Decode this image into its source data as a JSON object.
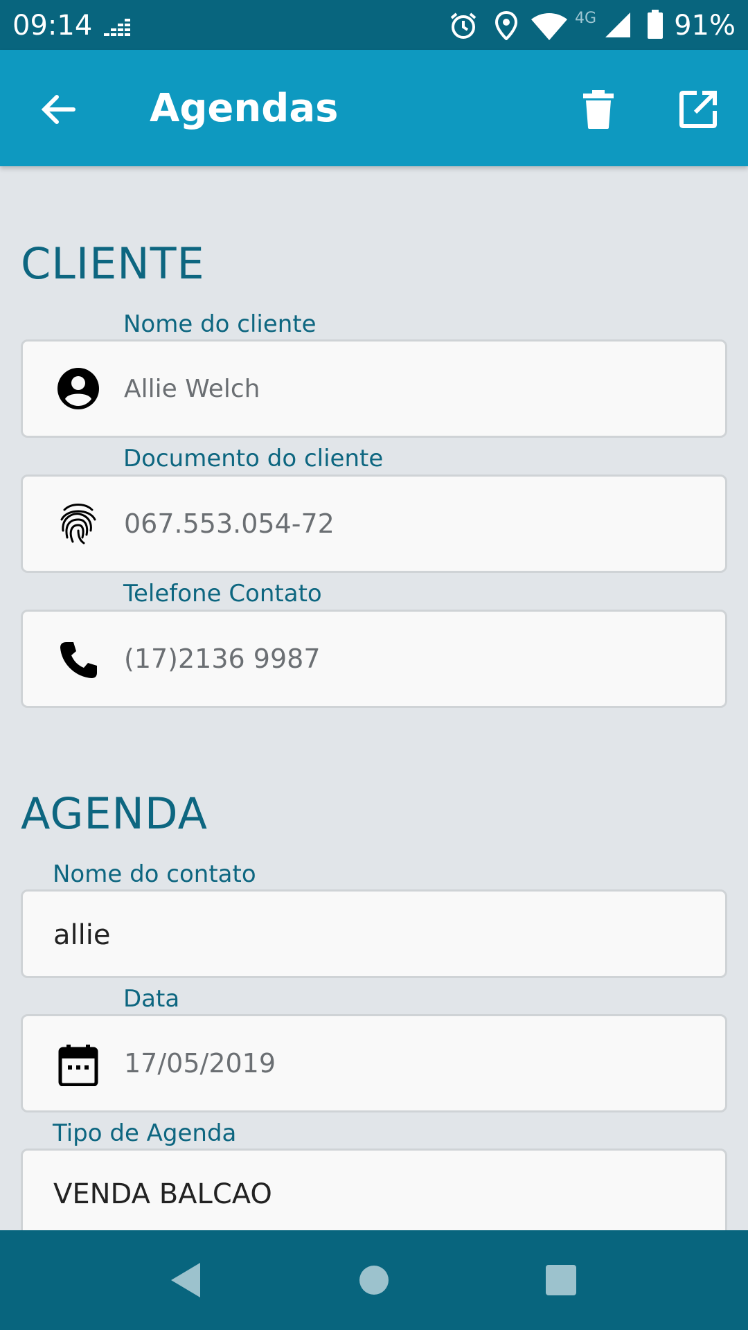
{
  "status_bar": {
    "time": "09:14",
    "network": "4G",
    "battery": "91%",
    "icons": [
      "signal-strength-icon",
      "alarm-icon",
      "location-icon",
      "wifi-icon",
      "cell-signal-icon",
      "battery-icon"
    ]
  },
  "app_bar": {
    "title": "Agendas",
    "back_icon": "back-arrow-icon",
    "delete_icon": "trash-icon",
    "open_icon": "open-external-icon"
  },
  "cliente": {
    "section_title": "CLIENTE",
    "nome": {
      "label": "Nome do cliente",
      "value": "Allie Welch",
      "icon": "account-circle-icon"
    },
    "documento": {
      "label": "Documento do cliente",
      "value": "067.553.054-72",
      "icon": "fingerprint-icon"
    },
    "telefone": {
      "label": "Telefone Contato",
      "value": "(17)2136 9987",
      "icon": "phone-icon"
    }
  },
  "agenda": {
    "section_title": "AGENDA",
    "contato": {
      "label": "Nome do contato",
      "value": "allie"
    },
    "data": {
      "label": "Data",
      "value": "17/05/2019",
      "icon": "calendar-icon"
    },
    "tipo": {
      "label": "Tipo de Agenda",
      "value": "VENDA BALCAO"
    }
  },
  "nav_bar": {
    "icons": [
      "nav-back-icon",
      "nav-home-icon",
      "nav-recents-icon"
    ]
  },
  "colors": {
    "status_bar": "#08657e",
    "app_bar": "#0e99c0",
    "background": "#e1e5e9",
    "label": "#0d6680"
  }
}
